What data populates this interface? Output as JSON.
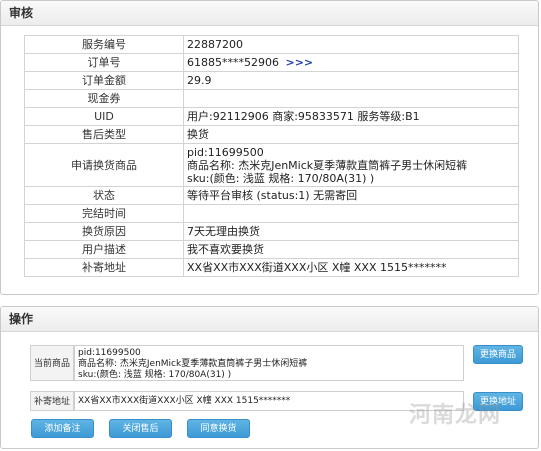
{
  "audit": {
    "title": "审核",
    "rows": [
      {
        "label": "服务编号",
        "value": "22887200"
      },
      {
        "label": "订单号",
        "value": "61885****52906",
        "link": ">>>"
      },
      {
        "label": "订单金额",
        "value": "29.9"
      },
      {
        "label": "现金券",
        "value": ""
      },
      {
        "label": "UID",
        "value": "用户:92112906  商家:95833571 服务等级:B1"
      },
      {
        "label": "售后类型",
        "value": "换货"
      },
      {
        "label": "申请换货商品",
        "lines": [
          "pid:11699500",
          "商品名称:  杰米克JenMick夏季薄款直筒裤子男士休闲短裤",
          "sku:(颜色:  浅蓝    规格:  170/80A(31)  )"
        ]
      },
      {
        "label": "状态",
        "value": "等待平台审核 (status:1) 无需寄回"
      },
      {
        "label": "完结时间",
        "value": ""
      },
      {
        "label": "换货原因",
        "value": "7天无理由换货"
      },
      {
        "label": "用户描述",
        "value": "我不喜欢要换货"
      },
      {
        "label": "补寄地址",
        "value": "XX省XX市XXX街道XXX小区 X幢    XXX 1515*******"
      }
    ]
  },
  "operation": {
    "title": "操作",
    "current_product_label": "当前商品",
    "current_product_lines": [
      "pid:11699500",
      "商品名称:  杰米克JenMick夏季薄款直筒裤子男士休闲短裤",
      "sku:(颜色:  浅蓝    规格:  170/80A(31)  )"
    ],
    "change_product_button": "更换商品",
    "address_label": "补寄地址",
    "address_value": "XX省XX市XXX街道XXX小区 X幢    XXX 1515*******",
    "change_address_button": "更换地址",
    "add_note_button": "添加备注",
    "close_aftersale_button": "关闭售后",
    "approve_exchange_button": "同意换货"
  },
  "watermark": "河南龙网"
}
